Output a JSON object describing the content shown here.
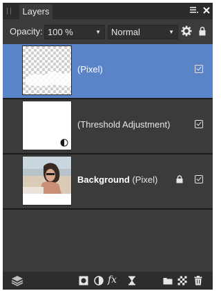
{
  "panel": {
    "tab_label": "Layers"
  },
  "options": {
    "opacity_label": "Opacity:",
    "opacity_value": "100 %",
    "blend_mode": "Normal"
  },
  "layers": [
    {
      "name": "",
      "type": "(Pixel)",
      "visible": true,
      "selected": true,
      "locked": false
    },
    {
      "name": "",
      "type": "(Threshold Adjustment)",
      "visible": true,
      "selected": false,
      "locked": false
    },
    {
      "name": "Background",
      "type": "(Pixel)",
      "visible": true,
      "selected": false,
      "locked": true
    }
  ],
  "colors": {
    "panel_bg": "#3b3b3b",
    "selection": "#5b83c8",
    "separator": "#1a1a1a"
  },
  "icons": {
    "title_bar": [
      "grip-icon",
      "panel-menu-icon",
      "close-icon"
    ],
    "options_bar": [
      "settings-icon",
      "lock-icon"
    ],
    "bottom_bar": [
      "layer-stack-icon",
      "mask-icon",
      "adjustment-icon",
      "fx-icon",
      "live-filter-icon",
      "new-group-icon",
      "new-pixel-layer-icon",
      "delete-icon"
    ]
  }
}
